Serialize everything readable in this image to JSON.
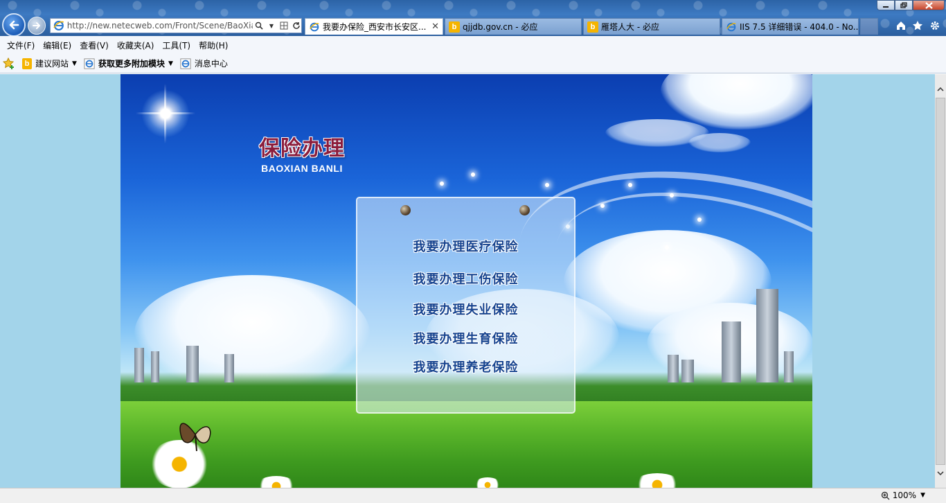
{
  "browser": {
    "address": "http://new.netecweb.com/Front/Scene/BaoXian",
    "tabs": [
      {
        "title": "我要办保险_西安市长安区...",
        "icon": "ie-icon",
        "active": true
      },
      {
        "title": "qjjdb.gov.cn - 必应",
        "icon": "bing-icon",
        "active": false
      },
      {
        "title": "雁塔人大 - 必应",
        "icon": "bing-icon",
        "active": false
      },
      {
        "title": "IIS 7.5 详细错误 - 404.0 - No...",
        "icon": "ie-icon",
        "active": false
      }
    ],
    "menu": [
      "文件(F)",
      "编辑(E)",
      "查看(V)",
      "收藏夹(A)",
      "工具(T)",
      "帮助(H)"
    ],
    "favorites": [
      {
        "label": "建议网站",
        "icon": "bing-icon",
        "dropdown": true
      },
      {
        "label": "获取更多附加模块",
        "icon": "ie-icon",
        "dropdown": true
      },
      {
        "label": "消息中心",
        "icon": "ie-icon",
        "dropdown": false
      }
    ],
    "zoom": "100%"
  },
  "page": {
    "logo_cn": "保险办理",
    "logo_en": "BAOXIAN BANLI",
    "links": [
      "我要办理医疗保险",
      "我要办理工伤保险",
      "我要办理失业保险",
      "我要办理生育保险",
      "我要办理养老保险"
    ]
  },
  "colors": {
    "page_background": "#a3d4ea",
    "link_text": "#16438f",
    "logo_text": "#8b1d3c"
  }
}
